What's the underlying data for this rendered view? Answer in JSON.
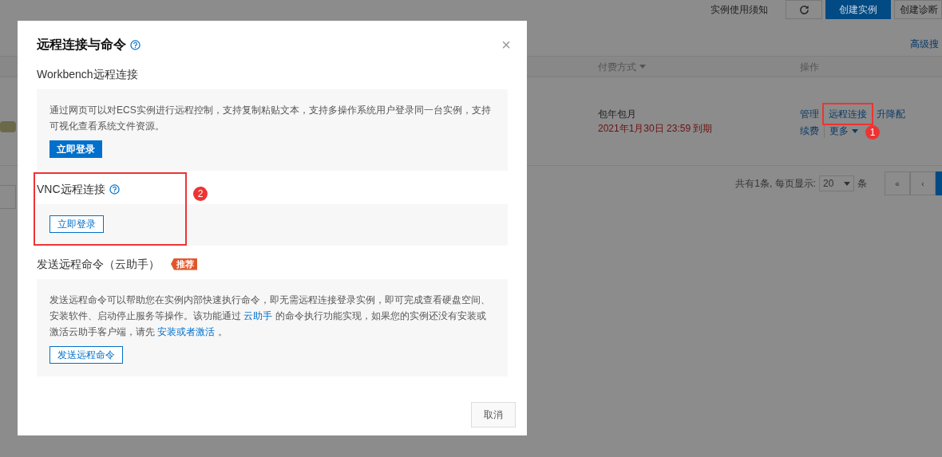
{
  "page": {
    "toolbar": {
      "notice_link": "实例使用须知",
      "create_button": "创建实例",
      "diagnose_button": "创建诊断"
    },
    "advanced_search": "高级搜",
    "table": {
      "columns": [
        {
          "label": "付费方式",
          "sortable": true
        },
        {
          "label": "操作",
          "sortable": false
        }
      ],
      "rows": [
        {
          "billing": "包年包月",
          "expiry": "2021年1月30日 23:59 到期",
          "actions": [
            {
              "label": "管理",
              "highlighted": false
            },
            {
              "label": "远程连接",
              "highlighted": true,
              "marker": "1"
            },
            {
              "label": "升降配",
              "highlighted": false
            }
          ],
          "actions_2": [
            {
              "label": "续费",
              "dropdown": false
            },
            {
              "label": "更多",
              "dropdown": true
            }
          ]
        }
      ]
    },
    "pagination": {
      "summary": "共有1条, 每页显示:",
      "page_size": "20",
      "unit": "条",
      "buttons": [
        "«",
        "‹"
      ]
    }
  },
  "dialog": {
    "title": "远程连接与命令",
    "close": "×",
    "sections": [
      {
        "kind": "primary",
        "title": "Workbench远程连接",
        "help": false,
        "description": "通过网页可以对ECS实例进行远程控制，支持复制粘贴文本，支持多操作系统用户登录同一台实例，支持可视化查看系统文件资源。",
        "button": "立即登录",
        "highlighted": false
      },
      {
        "kind": "outline",
        "title": "VNC远程连接",
        "help": true,
        "button": "立即登录",
        "highlighted": true,
        "marker": "2"
      },
      {
        "kind": "outline",
        "title": "发送远程命令（云助手）",
        "help": false,
        "badge": "推荐",
        "description_parts": [
          {
            "text": "发送远程命令可以帮助您在实例内部快速执行命令，即无需远程连接登录实例，即可完成查看硬盘空间、安装软件、启动停止服务等操作。该功能通过 ",
            "link": false
          },
          {
            "text": "云助手",
            "link": true
          },
          {
            "text": " 的命令执行功能实现，如果您的实例还没有安装或激活云助手客户端，请先 ",
            "link": false
          },
          {
            "text": "安装或者激活",
            "link": true
          },
          {
            "text": " 。",
            "link": false
          }
        ],
        "button": "发送远程命令",
        "highlighted": false
      }
    ],
    "cancel": "取消"
  }
}
